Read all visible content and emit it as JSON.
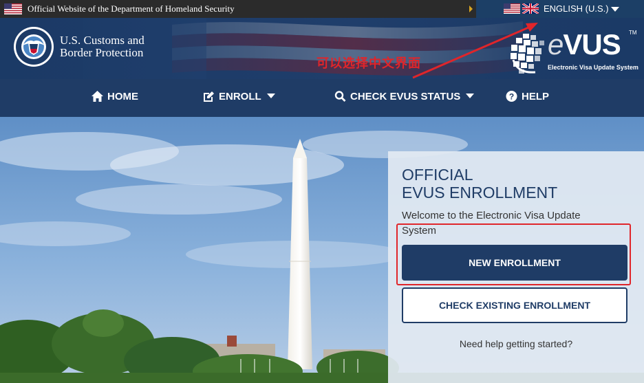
{
  "gov_bar": {
    "text": "Official Website of the Department of Homeland Security",
    "language": "ENGLISH (U.S.)"
  },
  "header": {
    "agency_line1": "U.S. Customs and",
    "agency_line2": "Border Protection",
    "annotation": "可以选择中文界面",
    "logo_word_e": "e",
    "logo_word_rest": "VUS",
    "logo_tm": "TM",
    "logo_subtitle": "Electronic Visa Update System"
  },
  "nav": {
    "items": [
      {
        "label": "HOME",
        "icon": "home-icon"
      },
      {
        "label": "ENROLL",
        "icon": "edit-icon"
      },
      {
        "label": "CHECK EVUS STATUS",
        "icon": "search-icon"
      },
      {
        "label": "HELP",
        "icon": "help-icon"
      }
    ]
  },
  "panel": {
    "title_line1": "OFFICIAL",
    "title_line2": "EVUS ENROLLMENT",
    "welcome": "Welcome to the Electronic Visa Update System",
    "new_enrollment": "NEW ENROLLMENT",
    "check_existing": "CHECK EXISTING ENROLLMENT",
    "help": "Need help getting started?"
  },
  "colors": {
    "navy": "#1f3c66",
    "annotation_red": "#e0252a",
    "gov_bar": "#2b2b2b"
  }
}
